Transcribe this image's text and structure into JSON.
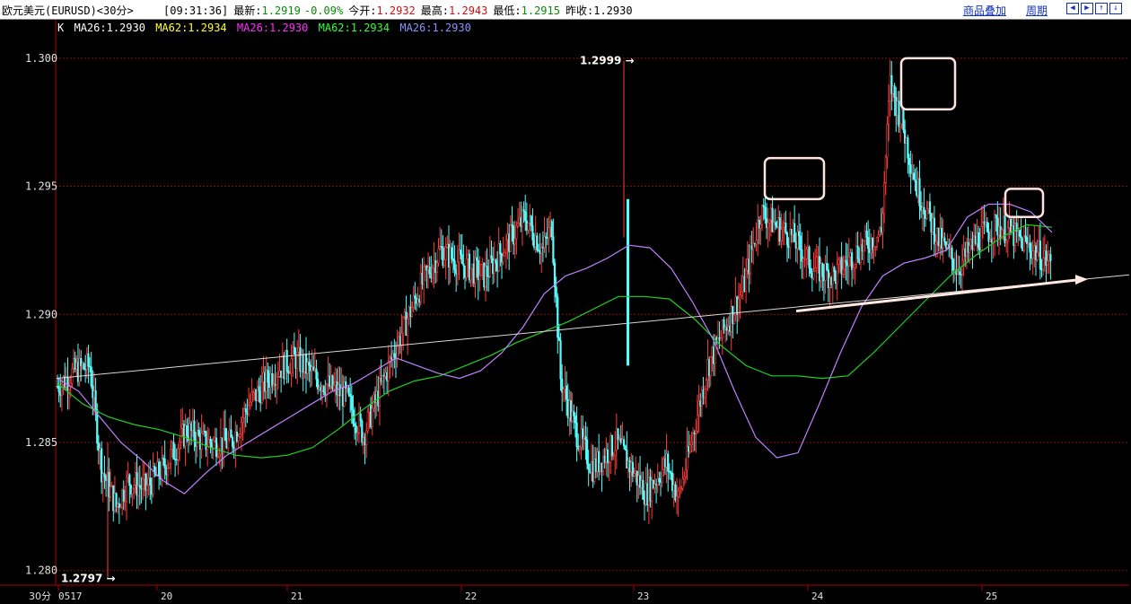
{
  "header": {
    "symbol": "欧元美元(EURUSD)<30分>",
    "time": "[09:31:36]",
    "latest_label": "最新:",
    "latest_value": "1.2919",
    "change": "-0.09%",
    "open_label": "今开:",
    "open_value": "1.2932",
    "high_label": "最高:",
    "high_value": "1.2943",
    "low_label": "最低:",
    "low_value": "1.2915",
    "prev_label": "昨收:",
    "prev_value": "1.2930",
    "overlay_link": "商品叠加",
    "period_link": "周期"
  },
  "legend": {
    "k": "K",
    "ma26_a": "MA26:1.2930",
    "ma62_a": "MA62:1.2934",
    "ma26_b": "MA26:1.2930",
    "ma62_b": "MA62:1.2934",
    "ma26_c": "MA26:1.2930"
  },
  "colors": {
    "up": "#ff3c3c",
    "down": "#54ffff",
    "ma26": "#c080ff",
    "ma62": "#20d020",
    "grid": "#8a1010",
    "axis": "#b00000",
    "legend_ma62": "#ffff30",
    "legend_ma26b": "#ff30ff",
    "legend_ma62b": "#30ff30",
    "legend_ma26c": "#9090ff"
  },
  "chart_data": {
    "type": "candlestick",
    "period_label": "30分",
    "x_tick_labels": [
      "0517",
      "20",
      "21",
      "22",
      "23",
      "24",
      "25"
    ],
    "y_tick_labels": [
      "1.300",
      "1.295",
      "1.290",
      "1.285",
      "1.280"
    ],
    "y_ticks": [
      1.3,
      1.295,
      1.29,
      1.285,
      1.28
    ],
    "ylim": [
      1.2795,
      1.3015
    ],
    "high_marker": "1.2999",
    "low_marker": "1.2797",
    "ma26": [
      1.2875,
      1.287,
      1.286,
      1.285,
      1.2843,
      1.2835,
      1.283,
      1.2838,
      1.2845,
      1.285,
      1.2855,
      1.286,
      1.2865,
      1.287,
      1.2873,
      1.2878,
      1.2883,
      1.288,
      1.2877,
      1.2875,
      1.2878,
      1.2885,
      1.2895,
      1.2908,
      1.2915,
      1.2918,
      1.2922,
      1.2927,
      1.2926,
      1.2918,
      1.2905,
      1.289,
      1.287,
      1.2852,
      1.2844,
      1.2846,
      1.2865,
      1.2885,
      1.2903,
      1.2915,
      1.292,
      1.2922,
      1.2925,
      1.2938,
      1.2943,
      1.2943,
      1.294,
      1.2932
    ],
    "ma62": [
      1.2873,
      1.2865,
      1.286,
      1.2857,
      1.2855,
      1.2852,
      1.2848,
      1.2845,
      1.2844,
      1.2845,
      1.2848,
      1.2855,
      1.2863,
      1.287,
      1.2874,
      1.2876,
      1.288,
      1.2884,
      1.2889,
      1.2893,
      1.2897,
      1.2902,
      1.2907,
      1.2907,
      1.2906,
      1.2898,
      1.2888,
      1.288,
      1.2876,
      1.2876,
      1.2875,
      1.2876,
      1.2885,
      1.2895,
      1.2905,
      1.2915,
      1.2923,
      1.293,
      1.2935,
      1.2934
    ],
    "trendlines": [
      {
        "from": [
          "0517",
          1.2875
        ],
        "to": [
          "25",
          1.2914
        ],
        "color": "#d8d8d8"
      },
      {
        "from": [
          "24",
          1.2902
        ],
        "to": [
          "25",
          1.2913
        ],
        "color": "#ffe8e0",
        "arrow": true
      }
    ],
    "highlight_boxes": [
      {
        "time": "24",
        "low": 1.2945,
        "high": 1.2961
      },
      {
        "time": "24",
        "low": 1.298,
        "high": 1.3
      },
      {
        "time": "25",
        "low": 1.2938,
        "high": 1.2949
      }
    ]
  }
}
